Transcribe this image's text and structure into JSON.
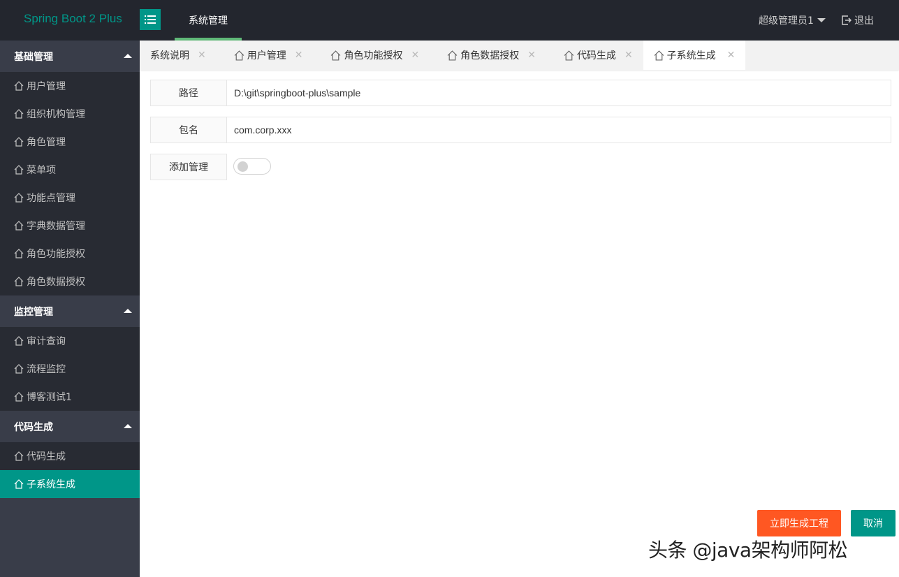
{
  "header": {
    "logo": "Spring Boot 2 Plus",
    "menu_toggle_icon": "list-icon",
    "top_nav": "系统管理",
    "user": "超级管理员1",
    "logout": "退出",
    "accent_color": "#009688"
  },
  "sidebar": {
    "groups": [
      {
        "title": "基础管理",
        "items": [
          "用户管理",
          "组织机构管理",
          "角色管理",
          "菜单项",
          "功能点管理",
          "字典数据管理",
          "角色功能授权",
          "角色数据授权"
        ]
      },
      {
        "title": "监控管理",
        "items": [
          "审计查询",
          "流程监控",
          "博客测试1"
        ]
      },
      {
        "title": "代码生成",
        "items": [
          "代码生成",
          "子系统生成"
        ]
      }
    ],
    "active_item": "子系统生成"
  },
  "tabs": [
    {
      "label": "系统说明",
      "has_icon": false
    },
    {
      "label": "用户管理",
      "has_icon": true
    },
    {
      "label": "角色功能授权",
      "has_icon": true
    },
    {
      "label": "角色数据授权",
      "has_icon": true
    },
    {
      "label": "代码生成",
      "has_icon": true
    },
    {
      "label": "子系统生成",
      "has_icon": true,
      "active": true
    }
  ],
  "form": {
    "path_label": "路径",
    "path_value": "D:\\git\\springboot-plus\\sample",
    "package_label": "包名",
    "package_value": "com.corp.xxx",
    "add_manage_label": "添加管理",
    "add_manage_enabled": false
  },
  "buttons": {
    "generate": "立即生成工程",
    "cancel": "取消"
  },
  "watermark": "头条 @java架构师阿松"
}
